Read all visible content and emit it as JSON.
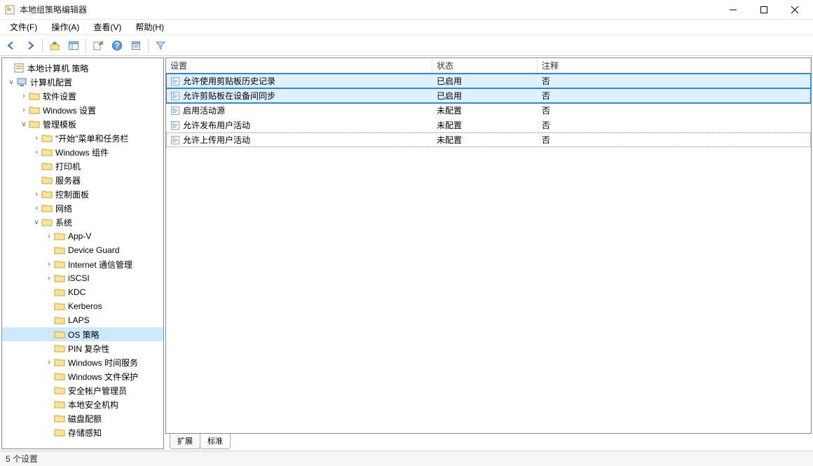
{
  "window": {
    "title": "本地组策略编辑器"
  },
  "menus": {
    "file": "文件(F)",
    "action": "操作(A)",
    "view": "查看(V)",
    "help": "帮助(H)"
  },
  "tree": {
    "root": "本地计算机 策略",
    "computer_config": "计算机配置",
    "software_settings": "软件设置",
    "windows_settings": "Windows 设置",
    "admin_templates": "管理模板",
    "start_taskbar": "\"开始\"菜单和任务栏",
    "windows_components": "Windows 组件",
    "printers": "打印机",
    "server": "服务器",
    "control_panel": "控制面板",
    "network": "网络",
    "system": "系统",
    "appv": "App-V",
    "device_guard": "Device Guard",
    "internet_comm": "Internet 通信管理",
    "iscsi": "iSCSI",
    "kdc": "KDC",
    "kerberos": "Kerberos",
    "laps": "LAPS",
    "os_policy": "OS 策略",
    "pin_complexity": "PIN 复杂性",
    "windows_time": "Windows 时间服务",
    "windows_file_protect": "Windows 文件保护",
    "security_account_mgr": "安全帐户管理员",
    "local_security_auth": "本地安全机构",
    "disk_quota": "磁盘配额",
    "storage_sense": "存储感知"
  },
  "columns": {
    "setting": "设置",
    "status": "状态",
    "comment": "注释"
  },
  "rows": [
    {
      "setting": "允许使用剪贴板历史记录",
      "status": "已启用",
      "comment": "否",
      "highlight": true
    },
    {
      "setting": "允许剪贴板在设备间同步",
      "status": "已启用",
      "comment": "否",
      "highlight": true
    },
    {
      "setting": "启用活动源",
      "status": "未配置",
      "comment": "否"
    },
    {
      "setting": "允许发布用户活动",
      "status": "未配置",
      "comment": "否"
    },
    {
      "setting": "允许上传用户活动",
      "status": "未配置",
      "comment": "否",
      "dotted": true
    }
  ],
  "tabs": {
    "extended": "扩展",
    "standard": "标准"
  },
  "status_text": "5 个设置"
}
